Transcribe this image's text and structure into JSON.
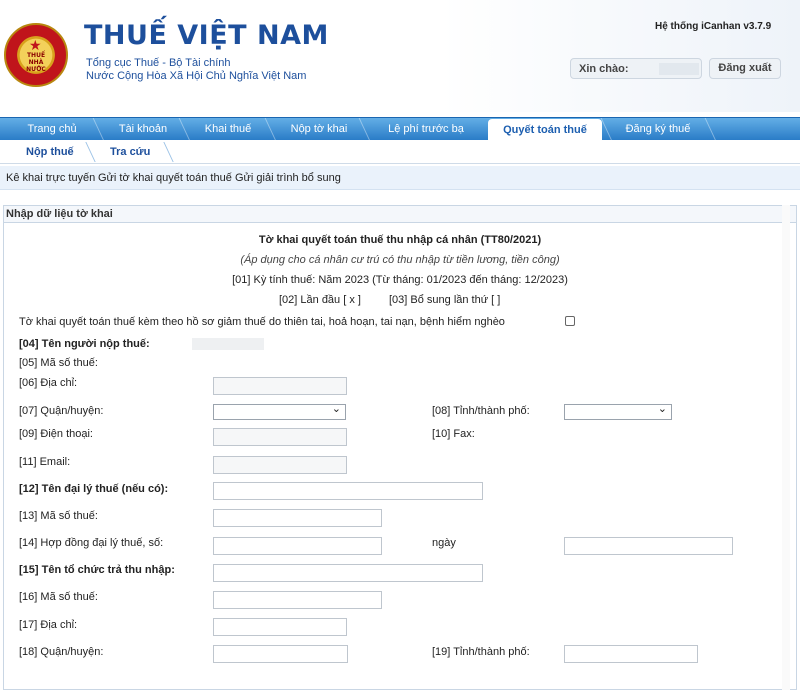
{
  "header": {
    "title": "THUẾ VIỆT NAM",
    "subtitle1": "Tổng cục Thuế - Bộ Tài chính",
    "subtitle2": "Nước Cộng Hòa Xã Hội Chủ Nghĩa Việt Nam",
    "logo_text": "THUẾ NHÀ NƯỚC",
    "system_version": "Hệ thống iCanhan v3.7.9",
    "greeting_label": "Xin chào:",
    "logout_label": "Đăng xuất"
  },
  "nav": {
    "items": [
      "Trang chủ",
      "Tài khoản",
      "Khai thuế",
      "Nộp tờ khai",
      "Lệ phí trước bạ",
      "Quyết toán thuế",
      "Đăng ký thuế"
    ],
    "active": "Quyết toán thuế"
  },
  "subnav": {
    "items": [
      "Nộp thuế",
      "Tra cứu"
    ]
  },
  "breadcrumb": {
    "items": [
      "Kê khai trực tuyến",
      "Gửi tờ khai quyết toán thuế",
      "Gửi giải trình bổ sung"
    ]
  },
  "panel": {
    "heading": "Nhập dữ liệu tờ khai"
  },
  "form": {
    "title": "Tờ khai quyết toán thuế thu nhập cá nhân (TT80/2021)",
    "note": "(Áp dụng cho cá nhân cư trú có thu nhập từ tiền lương, tiền công)",
    "period": "[01] Kỳ tính thuế:    Năm 2023 (Từ tháng: 01/2023 đến tháng: 12/2023)",
    "first_time": "[02] Lần đầu [ x ]",
    "supplement": "[03] Bổ sung lần thứ    [ ]",
    "disaster_label": "Tờ khai quyết toán thuế kèm theo hồ sơ giảm thuế do thiên tai, hoả hoạn, tai nạn, bệnh hiểm nghèo",
    "f04": "[04] Tên người nộp thuế:",
    "f05": "[05] Mã số thuế:",
    "f06": "[06] Địa chỉ:",
    "f07": "[07] Quận/huyện:",
    "f08": "[08] Tỉnh/thành phố:",
    "f09": "[09] Điện thoại:",
    "f10": "[10] Fax:",
    "f11": "[11] Email:",
    "f12": "[12] Tên đại lý thuế (nếu có):",
    "f13": "[13] Mã số thuế:",
    "f14": "[14] Hợp đồng đại lý thuế, số:",
    "f14_date": "ngày",
    "f15": "[15] Tên tổ chức trả thu nhập:",
    "f16": "[16] Mã số thuế:",
    "f17": "[17] Địa chỉ:",
    "f18": "[18] Quận/huyện:",
    "f19": "[19] Tỉnh/thành phố:"
  }
}
